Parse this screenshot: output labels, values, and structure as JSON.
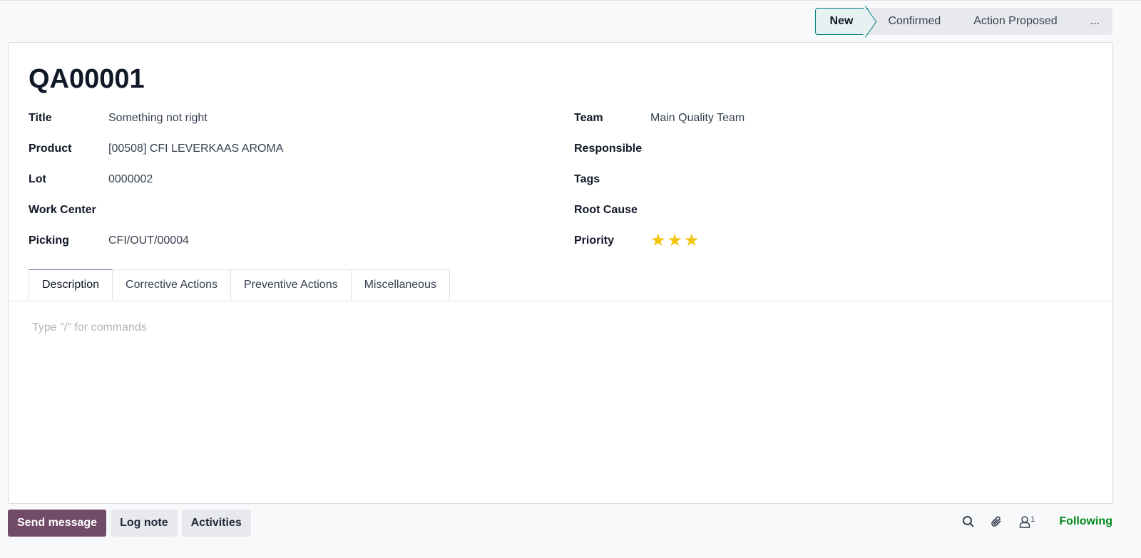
{
  "statusbar": {
    "stages": [
      "New",
      "Confirmed",
      "Action Proposed",
      "..."
    ],
    "active": "New"
  },
  "record": {
    "name": "QA00001",
    "left": [
      {
        "label": "Title",
        "value": "Something not right"
      },
      {
        "label": "Product",
        "value": "[00508] CFI LEVERKAAS AROMA"
      },
      {
        "label": "Lot",
        "value": "0000002"
      },
      {
        "label": "Work Center",
        "value": ""
      },
      {
        "label": "Picking",
        "value": "CFI/OUT/00004"
      }
    ],
    "right": [
      {
        "label": "Team",
        "value": "Main Quality Team"
      },
      {
        "label": "Responsible",
        "value": ""
      },
      {
        "label": "Tags",
        "value": ""
      },
      {
        "label": "Root Cause",
        "value": ""
      },
      {
        "label": "Priority",
        "value": "★★★"
      }
    ],
    "priority": 3,
    "star_color": "#f3c40f"
  },
  "tabs": [
    "Description",
    "Corrective Actions",
    "Preventive Actions",
    "Miscellaneous"
  ],
  "editor": {
    "placeholder": "Type \"/\" for commands"
  },
  "chatter": {
    "send": "Send message",
    "log": "Log note",
    "activities": "Activities",
    "followers_count": "1",
    "following": "Following"
  }
}
